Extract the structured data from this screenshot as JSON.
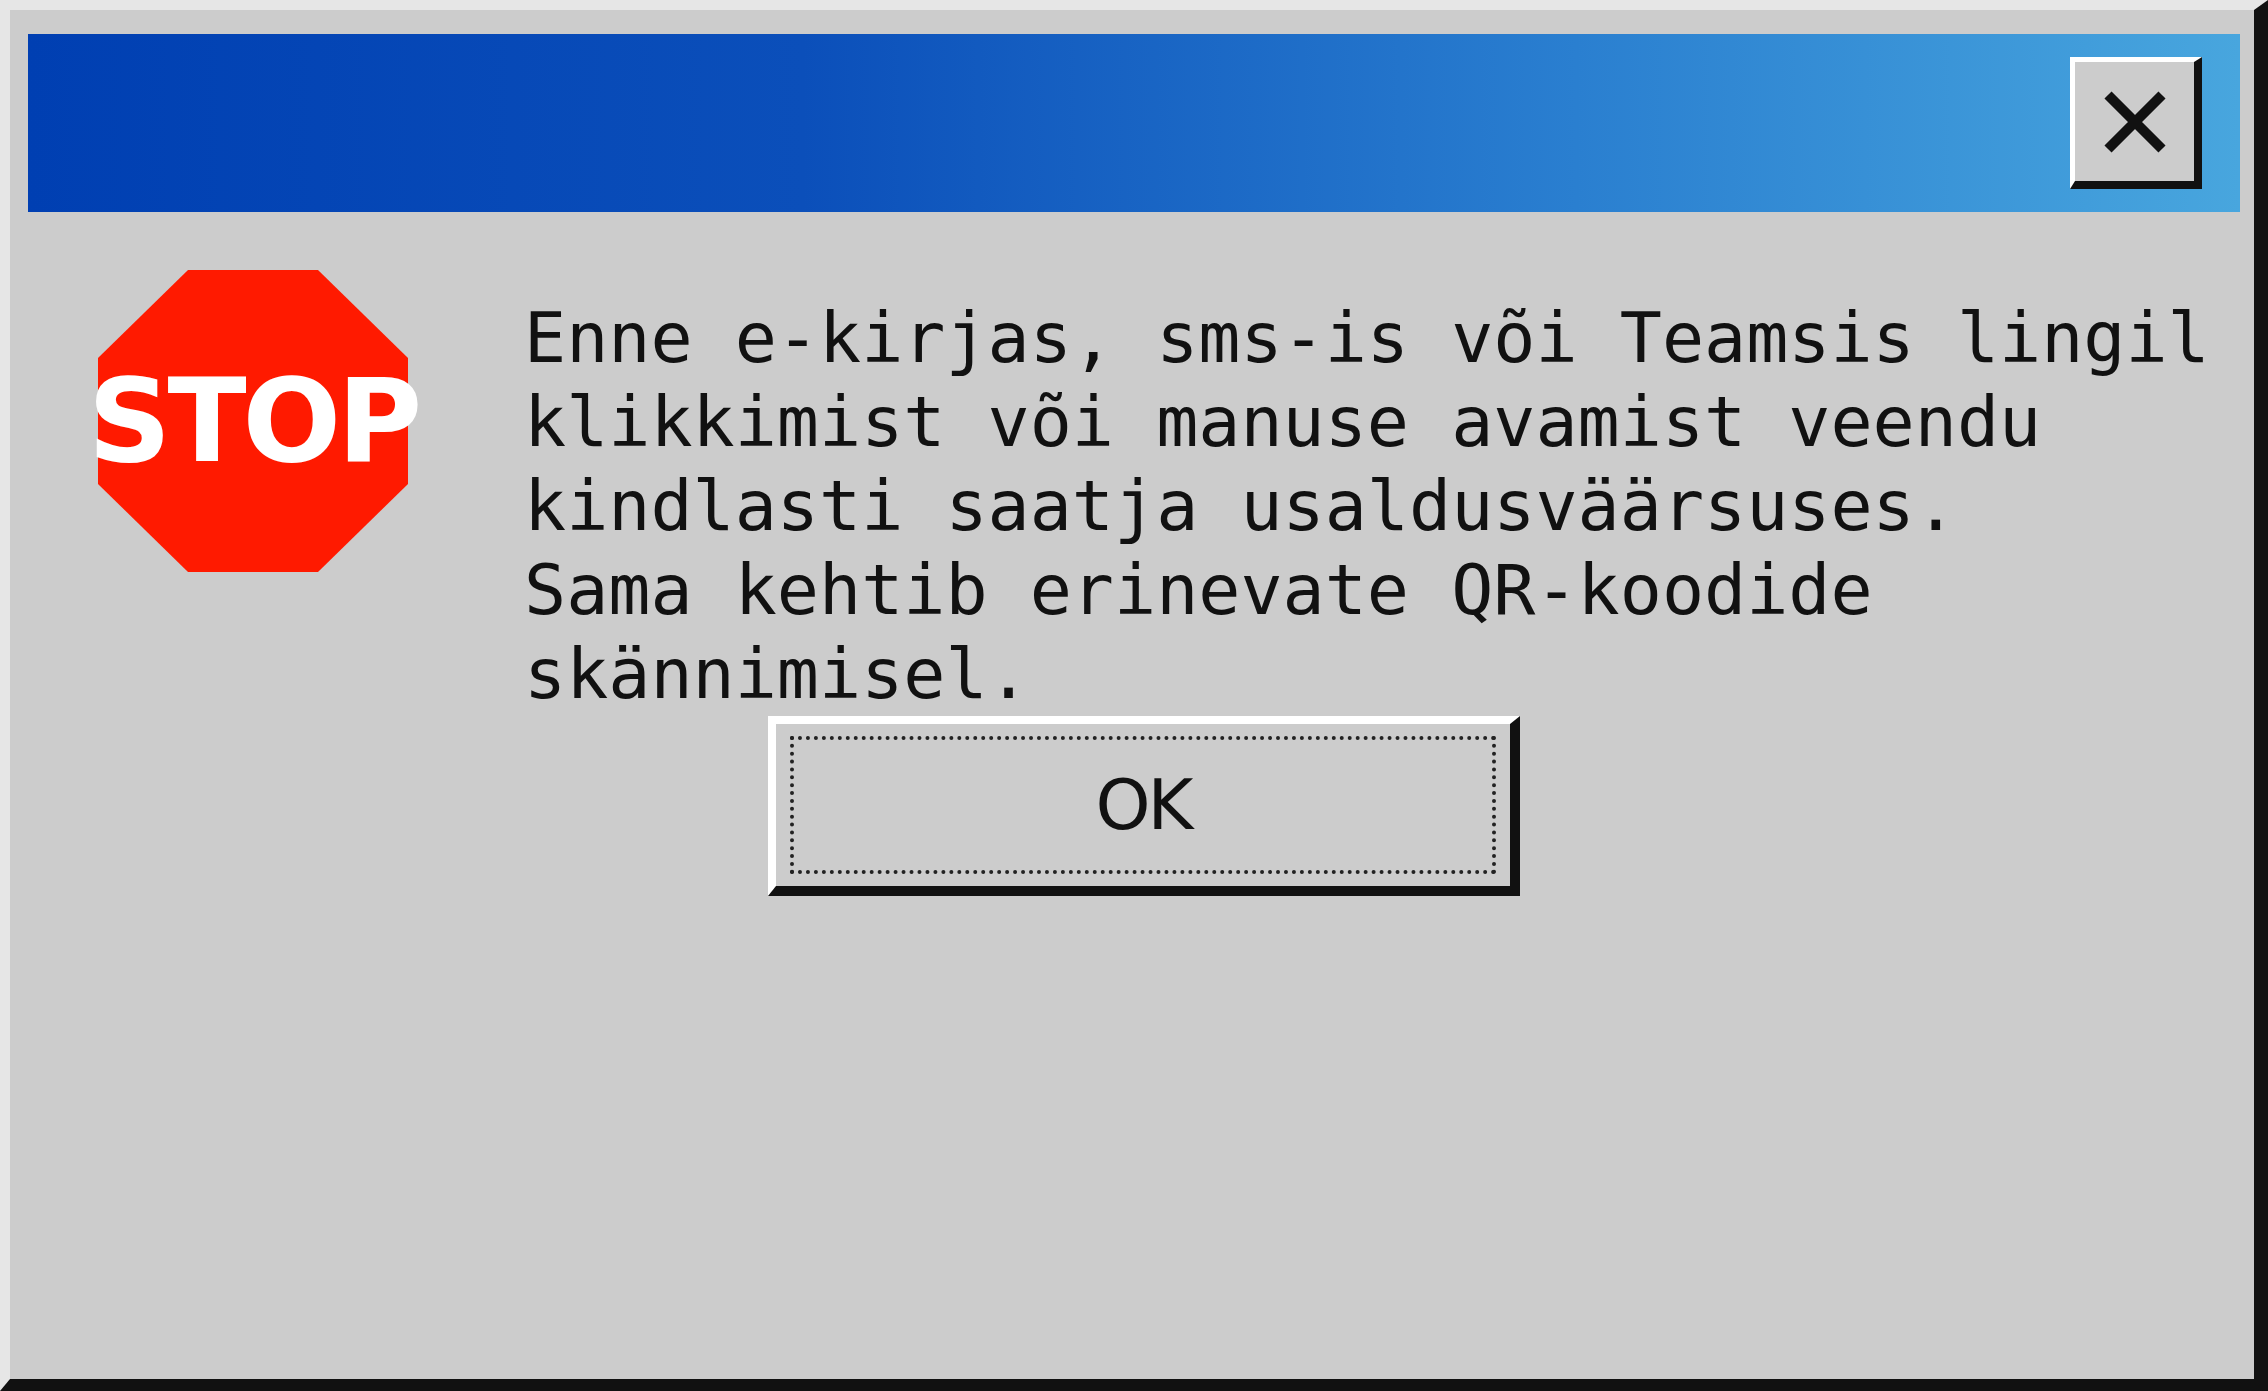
{
  "sign": "STOP",
  "message": [
    "Enne e-kirjas, sms-is või Teamsis lingil klikkimist või manuse avamist veendu kindlasti saatja usaldusväärsuses.",
    "Sama kehtib erinevate QR-koodide skännimisel."
  ],
  "buttons": [
    {
      "label": "OK",
      "focused": true
    }
  ]
}
